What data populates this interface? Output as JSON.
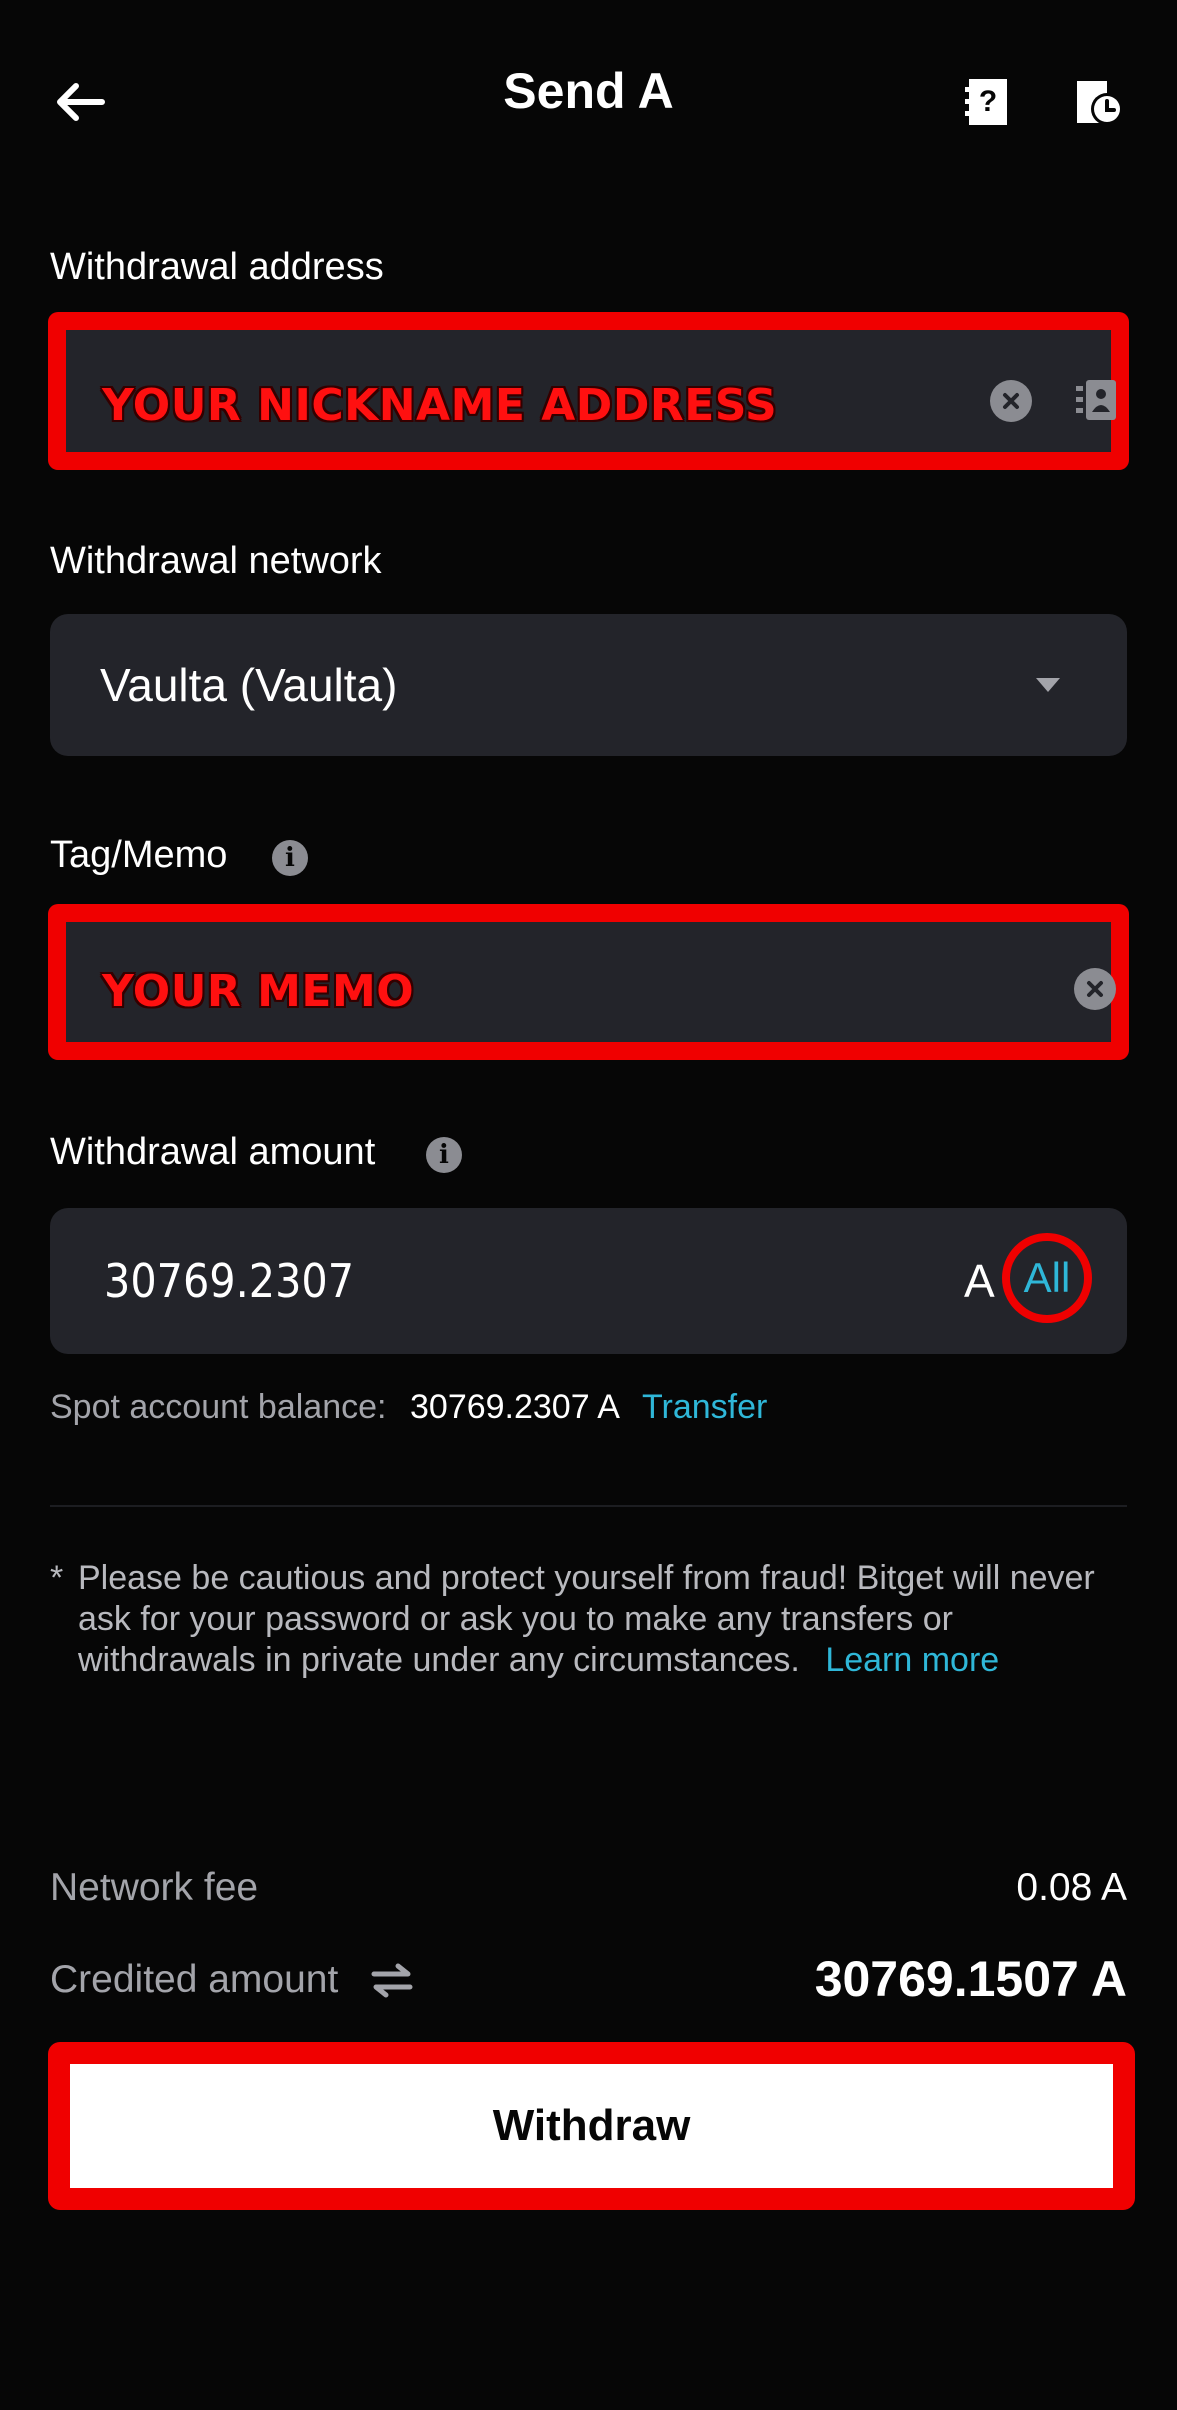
{
  "header": {
    "title": "Send A",
    "back_icon": "arrow-left-icon",
    "help_icon": "help-document-icon",
    "history_icon": "history-clock-icon"
  },
  "address": {
    "label": "Withdrawal address",
    "value": "YOUR NICKNAME ADDRESS",
    "clear_icon": "clear-icon",
    "address_book_icon": "address-book-icon"
  },
  "network": {
    "label": "Withdrawal network",
    "value": "Vaulta (Vaulta)",
    "dropdown_icon": "caret-down-icon"
  },
  "memo": {
    "label": "Tag/Memo",
    "info_icon": "info-icon",
    "value": "YOUR MEMO",
    "clear_icon": "clear-icon"
  },
  "amount": {
    "label": "Withdrawal amount",
    "info_icon": "info-icon",
    "value": "30769.2307",
    "unit": "A",
    "all_label": "All"
  },
  "balance": {
    "label": "Spot account balance:",
    "value": "30769.2307 A",
    "transfer_label": "Transfer"
  },
  "notice": {
    "star": "*",
    "text": "Please be cautious and protect yourself from fraud! Bitget will never ask for your password or ask you to make any transfers or withdrawals in private under any circumstances.",
    "link": "Learn more"
  },
  "fees": {
    "network_fee_label": "Network fee",
    "network_fee_value": "0.08 A",
    "credited_label": "Credited amount",
    "credited_icon": "swap-arrows-icon",
    "credited_value": "30769.1507 A"
  },
  "withdraw_button": {
    "label": "Withdraw"
  },
  "colors": {
    "background": "#060606",
    "field": "#23242a",
    "highlight_red": "#f00000",
    "accent_cyan": "#2fb7d8",
    "muted_text": "#a3a4aa"
  }
}
